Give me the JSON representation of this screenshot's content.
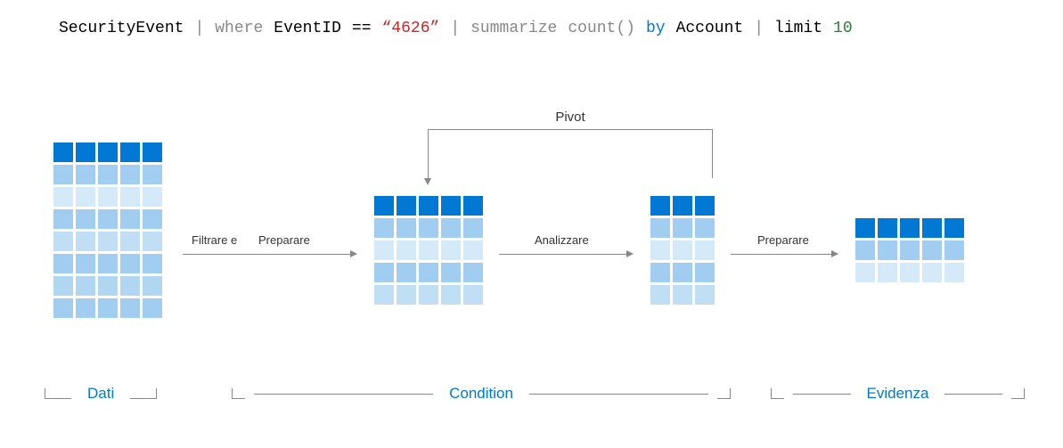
{
  "query": {
    "table": "SecurityEvent",
    "pipe1": "|",
    "where": "where",
    "eventid": "EventID",
    "eq": "==",
    "value": "“4626”",
    "pipe2": "|",
    "summarize": "summarize",
    "count": "count()",
    "by": "by",
    "account": "Account",
    "pipe3": "|",
    "limit": "limit",
    "limit_n": "10"
  },
  "labels": {
    "pivot": "Pivot",
    "filtrare": "Filtrare e",
    "preparare1": "Preparare",
    "analizzare": "Analizzare",
    "preparare2": "Preparare"
  },
  "sections": {
    "dati": "Dati",
    "condition": "Condition",
    "evidenza": "Evidenza"
  },
  "grids": {
    "a": {
      "cols": 5,
      "rows": 8
    },
    "b": {
      "cols": 5,
      "rows": 5
    },
    "c": {
      "cols": 3,
      "rows": 5
    },
    "d": {
      "cols": 5,
      "rows": 3
    }
  }
}
